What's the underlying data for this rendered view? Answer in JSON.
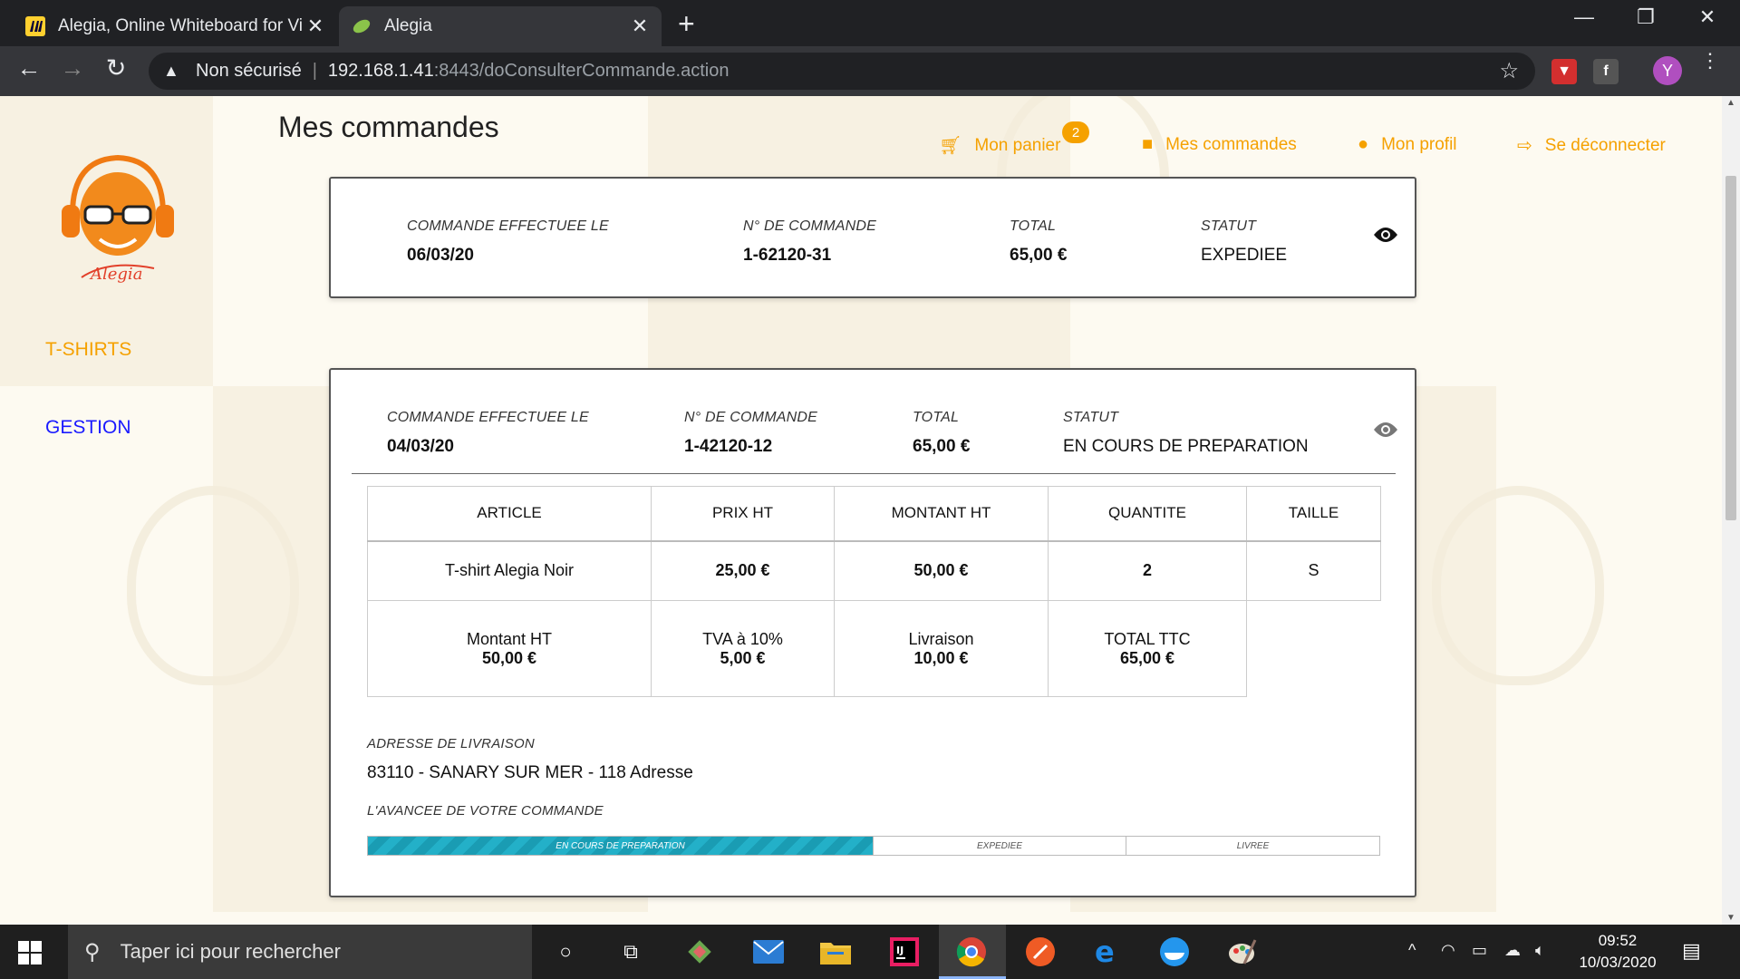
{
  "browser": {
    "tabs": [
      {
        "title": "Alegia, Online Whiteboard for Vi",
        "active": false
      },
      {
        "title": "Alegia",
        "active": true
      }
    ],
    "security_label": "Non sécurisé",
    "url_host": "192.168.1.41",
    "url_path": ":8443/doConsulterCommande.action",
    "avatar_letter": "Y"
  },
  "page": {
    "title": "Mes commandes",
    "nav": {
      "cart_label": "Mon panier",
      "cart_count": "2",
      "orders_label": "Mes commandes",
      "profile_label": "Mon profil",
      "logout_label": "Se déconnecter"
    },
    "sidebar": {
      "tshirts": "T-SHIRTS",
      "gestion": "GESTION"
    },
    "labels": {
      "date": "COMMANDE EFFECTUEE LE",
      "number": "N° DE COMMANDE",
      "total": "TOTAL",
      "status": "STATUT"
    },
    "orders": [
      {
        "date": "06/03/20",
        "number": "1-62120-31",
        "total": "65,00 €",
        "status": "EXPEDIEE"
      },
      {
        "date": "04/03/20",
        "number": "1-42120-12",
        "total": "65,00 €",
        "status": "EN COURS DE PREPARATION"
      }
    ],
    "detail": {
      "columns": [
        "ARTICLE",
        "PRIX HT",
        "MONTANT HT",
        "QUANTITE",
        "TAILLE"
      ],
      "row": {
        "article": "T-shirt Alegia Noir",
        "prix_ht": "25,00 €",
        "montant_ht": "50,00 €",
        "quantite": "2",
        "taille": "S"
      },
      "totals": {
        "montant_ht_label": "Montant HT",
        "montant_ht": "50,00 €",
        "tva_label": "TVA à 10%",
        "tva": "5,00 €",
        "livraison_label": "Livraison",
        "livraison": "10,00 €",
        "ttc_label": "TOTAL TTC",
        "ttc": "65,00 €"
      },
      "address_label": "ADRESSE DE LIVRAISON",
      "address": "83110 - SANARY SUR MER - 118 Adresse",
      "progress_label": "L'AVANCEE DE VOTRE COMMANDE",
      "progress_steps": [
        "EN COURS DE PREPARATION",
        "EXPEDIEE",
        "LIVREE"
      ],
      "progress_value": 0.5
    }
  },
  "taskbar": {
    "search_placeholder": "Taper ici pour rechercher",
    "time": "09:52",
    "date": "10/03/2020"
  },
  "colors": {
    "accent": "#f5a100",
    "gestion_link": "#1a1aff",
    "progress": "#23b0c8"
  }
}
